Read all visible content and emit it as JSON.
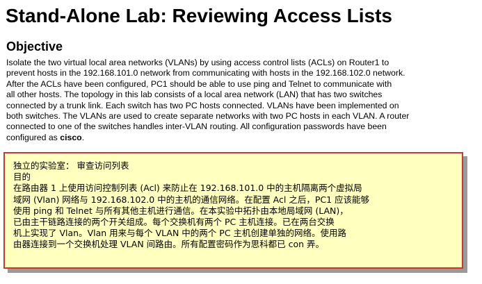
{
  "title": "Stand-Alone Lab: Reviewing Access Lists",
  "objective": {
    "heading": "Objective",
    "lines": [
      "Isolate the two virtual local area networks (VLANs) by using access control lists (ACLs) on Router1 to",
      "prevent hosts in the 192.168.101.0 network from communicating with hosts in the 192.168.102.0 network.",
      "After the ACLs have been configured, PC1 should be able to use ping and Telnet to communicate with",
      "all other hosts. The topology in this lab consists of a local area network (LAN) that has two switches",
      "connected by a trunk link. Each switch has two PC hosts connected. VLANs have been implemented on",
      "both switches. The VLANs are used to create separate networks with two PC hosts in each VLAN. A router",
      "connected to one of the switches handles inter-VLAN routing. All configuration passwords have been"
    ],
    "last_line_prefix": "configured as ",
    "password": "cisco",
    "last_line_suffix": "."
  },
  "translation": {
    "lines": [
      "独立的实验室： 审查访问列表",
      "目的",
      "在路由器 1 上使用访问控制列表 (Acl) 来防止在 192.168.101.0 中的主机隔离两个虚拟局",
      "域网 (Vlan) 网络与 192.168.102.0 中的主机的通信网络。在配置 Acl 之后，PC1 应该能够",
      "使用 ping 和 Telnet 与所有其他主机进行通信。在本实验中拓扑由本地局域网 (LAN)，",
      "已由主干链路连接的两个开关组成。每个交换机有两个 PC 主机连接。已在两台交换",
      "机上实现了 Vlan。Vlan 用来与每个 VLAN 中的两个 PC 主机创建单独的网络。使用路",
      "由器连接到一个交换机处理 VLAN 间路由。所有配置密码作为思科都已 con 弄。"
    ]
  },
  "colors": {
    "note_background": "#ffffc0",
    "note_border": "#c43a2e",
    "note_shadow": "#9a9a9a"
  }
}
